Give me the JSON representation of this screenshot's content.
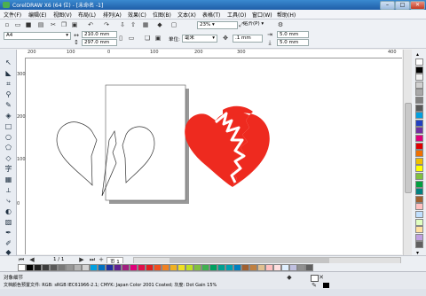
{
  "title": "CorelDRAW X6 (64 位) - [未命名 -1]",
  "window_buttons": {
    "minimize": "–",
    "restore": "□",
    "close": "✕"
  },
  "menu": [
    "文件(F)",
    "编辑(E)",
    "视图(V)",
    "布局(L)",
    "排列(A)",
    "效果(C)",
    "位图(B)",
    "文本(X)",
    "表格(T)",
    "工具(O)",
    "窗口(W)",
    "帮助(H)"
  ],
  "toolbar": {
    "zoom": "23%",
    "snap": "贴齐(P)"
  },
  "property_bar": {
    "page_size": "A4",
    "width": "210.0 mm",
    "height": "297.0 mm",
    "unit": "毫米",
    "nudge": ".1 mm",
    "dup_x": "5.0 mm",
    "dup_y": "5.0 mm"
  },
  "ruler_top_labels": [
    "200",
    "100",
    "0",
    "100",
    "200",
    "300",
    "400"
  ],
  "ruler_left_labels": [
    "300",
    "200",
    "100",
    "0"
  ],
  "page_nav": {
    "counter": "1 / 1",
    "page_tab": "页 1"
  },
  "status": {
    "label": "对象细节",
    "profile": "文档颜色预置文件: RGB: sRGB IEC61966-2.1; CMYK: Japan Color 2001 Coated; 灰度: Dot Gain 15%"
  },
  "colors": {
    "heart_fill": "#ee2a1f",
    "titlebar": "#2b72c0",
    "page": "#ffffff"
  },
  "palette_colors": [
    "#ffffff",
    "#000000",
    "#f0f0f0",
    "#d0d0d0",
    "#a8a8a8",
    "#808080",
    "#585858",
    "#00a0e0",
    "#2040c0",
    "#7030a0",
    "#e0007a",
    "#e00000",
    "#f07000",
    "#f0c000",
    "#ffff00",
    "#80c040",
    "#00a040",
    "#008080",
    "#a06030",
    "#ffc0c0",
    "#c0e0ff",
    "#e0ffc0",
    "#ffe0a0",
    "#c0a0e0",
    "#606060"
  ],
  "hpalette_colors": [
    "#ffffff",
    "#000000",
    "#1f1f1f",
    "#3c3c3c",
    "#5a5a5a",
    "#787878",
    "#969696",
    "#b4b4b4",
    "#d2d2d2",
    "#00a0e0",
    "#0070c0",
    "#2030a0",
    "#602090",
    "#a02080",
    "#e0007a",
    "#e0104a",
    "#e02020",
    "#f05020",
    "#f08020",
    "#f0b020",
    "#f0e020",
    "#c0e020",
    "#80c040",
    "#40b050",
    "#00a060",
    "#00a090",
    "#00a0b0",
    "#0080c0",
    "#a06030",
    "#c08040",
    "#e0c090",
    "#ffc0c0",
    "#ffe0e0",
    "#e0f0ff",
    "#c0c0e0",
    "#909090",
    "#606060"
  ]
}
